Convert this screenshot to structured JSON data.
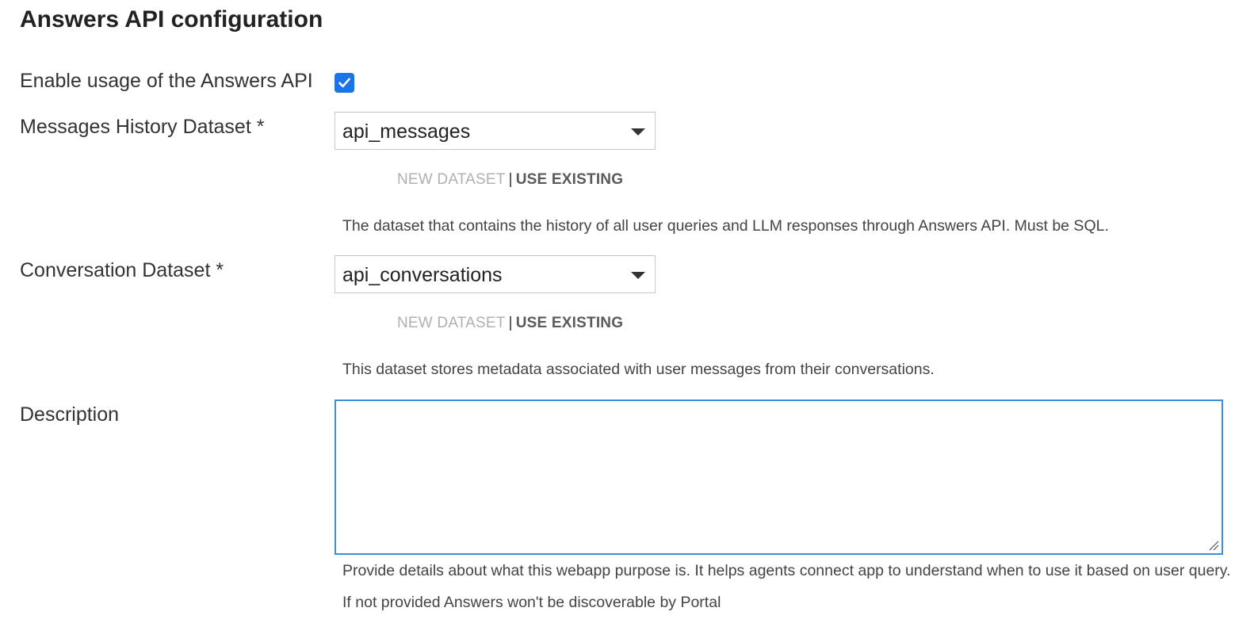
{
  "section": {
    "title": "Answers API configuration"
  },
  "enable": {
    "label": "Enable usage of the Answers API",
    "checked": true
  },
  "messages_history": {
    "label": "Messages History Dataset *",
    "value": "api_messages",
    "new_dataset": "NEW DATASET",
    "separator": "|",
    "use_existing": "USE EXISTING",
    "help": "The dataset that contains the history of all user queries and LLM responses through Answers API. Must be SQL."
  },
  "conversation": {
    "label": "Conversation Dataset *",
    "value": "api_conversations",
    "new_dataset": "NEW DATASET",
    "separator": "|",
    "use_existing": "USE EXISTING",
    "help": "This dataset stores metadata associated with user messages from their conversations."
  },
  "description": {
    "label": "Description",
    "value": "",
    "help_line1": "Provide details about what this webapp purpose is. It helps agents connect app to understand when to use it based on user query.",
    "help_line2": "If not provided Answers won't be discoverable by Portal"
  },
  "colors": {
    "accent": "#1a73e8",
    "focus_border": "#3b8ed8"
  },
  "icons": {
    "checkbox": "check-icon",
    "select": "caret-down-icon",
    "textarea": "resize-grip-icon"
  }
}
